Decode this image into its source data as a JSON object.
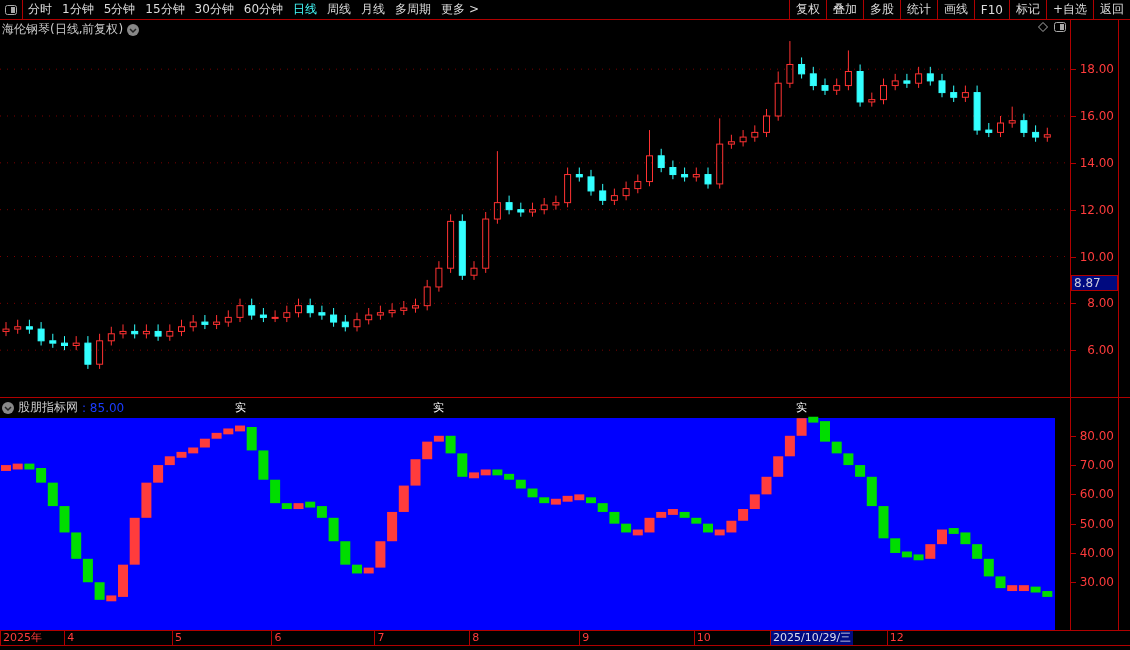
{
  "toolbar": {
    "tabs": [
      {
        "label": "分时",
        "selected": false
      },
      {
        "label": "1分钟",
        "selected": false
      },
      {
        "label": "5分钟",
        "selected": false
      },
      {
        "label": "15分钟",
        "selected": false
      },
      {
        "label": "30分钟",
        "selected": false
      },
      {
        "label": "60分钟",
        "selected": false
      },
      {
        "label": "日线",
        "selected": true
      },
      {
        "label": "周线",
        "selected": false
      },
      {
        "label": "月线",
        "selected": false
      },
      {
        "label": "多周期",
        "selected": false
      },
      {
        "label": "更多 >",
        "selected": false
      }
    ],
    "buttons": [
      "复权",
      "叠加",
      "多股",
      "统计",
      "画线",
      "F10",
      "标记",
      "+自选",
      "返回"
    ]
  },
  "price_panel": {
    "title": "海伦钢琴(日线,前复权)",
    "price_cursor": "8.87",
    "chart_data": {
      "type": "candlestick",
      "grid": true,
      "ylim": [
        4,
        20.1
      ],
      "yticks": [
        {
          "value": 6,
          "label": "6.00"
        },
        {
          "value": 8,
          "label": "8.00"
        },
        {
          "value": 10,
          "label": "10.00"
        },
        {
          "value": 12,
          "label": "12.00"
        },
        {
          "value": 14,
          "label": "14.00"
        },
        {
          "value": 16,
          "label": "16.00"
        },
        {
          "value": 18,
          "label": "18.00"
        }
      ],
      "ohlc": [
        [
          6.8,
          7.2,
          6.6,
          6.9
        ],
        [
          6.9,
          7.3,
          6.7,
          7.0
        ],
        [
          7.0,
          7.3,
          6.7,
          6.9
        ],
        [
          6.9,
          7.2,
          6.2,
          6.4
        ],
        [
          6.4,
          6.7,
          6.1,
          6.3
        ],
        [
          6.3,
          6.6,
          6.0,
          6.2
        ],
        [
          6.2,
          6.6,
          6.0,
          6.3
        ],
        [
          6.3,
          6.6,
          5.2,
          5.4
        ],
        [
          5.4,
          6.7,
          5.2,
          6.4
        ],
        [
          6.4,
          7.0,
          6.2,
          6.7
        ],
        [
          6.7,
          7.1,
          6.5,
          6.8
        ],
        [
          6.8,
          7.1,
          6.5,
          6.7
        ],
        [
          6.7,
          7.1,
          6.5,
          6.8
        ],
        [
          6.8,
          7.1,
          6.4,
          6.6
        ],
        [
          6.6,
          7.1,
          6.4,
          6.8
        ],
        [
          6.8,
          7.3,
          6.6,
          7.0
        ],
        [
          7.0,
          7.5,
          6.8,
          7.2
        ],
        [
          7.2,
          7.5,
          6.9,
          7.1
        ],
        [
          7.1,
          7.5,
          6.9,
          7.2
        ],
        [
          7.2,
          7.7,
          7.0,
          7.4
        ],
        [
          7.4,
          8.2,
          7.2,
          7.9
        ],
        [
          7.9,
          8.2,
          7.3,
          7.5
        ],
        [
          7.5,
          7.8,
          7.2,
          7.4
        ],
        [
          7.4,
          7.7,
          7.2,
          7.4
        ],
        [
          7.4,
          7.9,
          7.2,
          7.6
        ],
        [
          7.6,
          8.2,
          7.4,
          7.9
        ],
        [
          7.9,
          8.2,
          7.4,
          7.6
        ],
        [
          7.6,
          7.9,
          7.3,
          7.5
        ],
        [
          7.5,
          7.8,
          7.0,
          7.2
        ],
        [
          7.2,
          7.5,
          6.8,
          7.0
        ],
        [
          7.0,
          7.6,
          6.8,
          7.3
        ],
        [
          7.3,
          7.8,
          7.1,
          7.5
        ],
        [
          7.5,
          7.9,
          7.3,
          7.6
        ],
        [
          7.6,
          8.0,
          7.4,
          7.7
        ],
        [
          7.7,
          8.1,
          7.5,
          7.8
        ],
        [
          7.8,
          8.2,
          7.6,
          7.9
        ],
        [
          7.9,
          9.0,
          7.7,
          8.7
        ],
        [
          8.7,
          9.8,
          8.5,
          9.5
        ],
        [
          9.5,
          11.8,
          9.3,
          11.5
        ],
        [
          11.5,
          11.8,
          9.0,
          9.2
        ],
        [
          9.2,
          9.8,
          9.0,
          9.5
        ],
        [
          9.5,
          11.9,
          9.3,
          11.6
        ],
        [
          11.6,
          14.5,
          11.4,
          12.3
        ],
        [
          12.3,
          12.6,
          11.8,
          12.0
        ],
        [
          12.0,
          12.3,
          11.7,
          11.9
        ],
        [
          11.9,
          12.3,
          11.7,
          12.0
        ],
        [
          12.0,
          12.5,
          11.8,
          12.2
        ],
        [
          12.2,
          12.6,
          12.0,
          12.3
        ],
        [
          12.3,
          13.8,
          12.1,
          13.5
        ],
        [
          13.5,
          13.8,
          13.2,
          13.4
        ],
        [
          13.4,
          13.7,
          12.6,
          12.8
        ],
        [
          12.8,
          13.1,
          12.2,
          12.4
        ],
        [
          12.4,
          12.9,
          12.2,
          12.6
        ],
        [
          12.6,
          13.2,
          12.4,
          12.9
        ],
        [
          12.9,
          13.5,
          12.7,
          13.2
        ],
        [
          13.2,
          15.4,
          13.0,
          14.3
        ],
        [
          14.3,
          14.6,
          13.6,
          13.8
        ],
        [
          13.8,
          14.1,
          13.3,
          13.5
        ],
        [
          13.5,
          13.8,
          13.2,
          13.4
        ],
        [
          13.4,
          13.8,
          13.2,
          13.5
        ],
        [
          13.5,
          13.8,
          12.9,
          13.1
        ],
        [
          13.1,
          15.9,
          12.9,
          14.8
        ],
        [
          14.8,
          15.2,
          14.6,
          14.9
        ],
        [
          14.9,
          15.4,
          14.7,
          15.1
        ],
        [
          15.1,
          15.6,
          14.9,
          15.3
        ],
        [
          15.3,
          16.3,
          15.1,
          16.0
        ],
        [
          16.0,
          17.9,
          15.8,
          17.4
        ],
        [
          17.4,
          19.2,
          17.2,
          18.2
        ],
        [
          18.2,
          18.5,
          17.6,
          17.8
        ],
        [
          17.8,
          18.1,
          17.1,
          17.3
        ],
        [
          17.3,
          17.6,
          16.9,
          17.1
        ],
        [
          17.1,
          17.6,
          16.9,
          17.3
        ],
        [
          17.3,
          18.8,
          17.1,
          17.9
        ],
        [
          17.9,
          18.2,
          16.4,
          16.6
        ],
        [
          16.6,
          17.0,
          16.4,
          16.7
        ],
        [
          16.7,
          17.6,
          16.5,
          17.3
        ],
        [
          17.3,
          17.8,
          17.1,
          17.5
        ],
        [
          17.5,
          17.8,
          17.2,
          17.4
        ],
        [
          17.4,
          18.1,
          17.2,
          17.8
        ],
        [
          17.8,
          18.1,
          17.3,
          17.5
        ],
        [
          17.5,
          17.8,
          16.8,
          17.0
        ],
        [
          17.0,
          17.3,
          16.6,
          16.8
        ],
        [
          16.8,
          17.3,
          16.6,
          17.0
        ],
        [
          17.0,
          17.3,
          15.2,
          15.4
        ],
        [
          15.4,
          15.7,
          15.1,
          15.3
        ],
        [
          15.3,
          16.0,
          15.1,
          15.7
        ],
        [
          15.7,
          16.4,
          15.5,
          15.8
        ],
        [
          15.8,
          16.1,
          15.1,
          15.3
        ],
        [
          15.3,
          15.6,
          14.9,
          15.1
        ],
        [
          15.1,
          15.5,
          14.9,
          15.2
        ]
      ]
    }
  },
  "indicator_panel": {
    "name": "股朋指标网",
    "value": ": 85.00",
    "date_axis": [
      "2025年",
      "4",
      "5",
      "6",
      "7",
      "8",
      "9",
      "10",
      "12"
    ],
    "date_cursor": "2025/10/29/三",
    "chart_data": {
      "type": "candlestick",
      "ylim": [
        13.7,
        92.9
      ],
      "yticks": [
        {
          "value": 30,
          "label": "30.00"
        },
        {
          "value": 40,
          "label": "40.00"
        },
        {
          "value": 50,
          "label": "50.00"
        },
        {
          "value": 60,
          "label": "60.00"
        },
        {
          "value": 70,
          "label": "70.00"
        },
        {
          "value": 80,
          "label": "80.00"
        }
      ],
      "ohlc": [
        [
          68,
          70,
          68,
          70
        ],
        [
          68.5,
          70.5,
          68.5,
          70.5
        ],
        [
          70.5,
          70.5,
          68.5,
          68.5
        ],
        [
          69,
          69,
          64,
          64
        ],
        [
          64,
          64,
          56,
          56
        ],
        [
          56,
          56,
          47,
          47
        ],
        [
          47,
          47,
          38,
          38
        ],
        [
          38,
          38,
          30,
          30
        ],
        [
          30,
          30,
          24,
          24
        ],
        [
          23.5,
          25.5,
          23.5,
          25.5
        ],
        [
          25,
          36,
          25,
          36
        ],
        [
          36,
          52,
          36,
          52
        ],
        [
          52,
          64,
          52,
          64
        ],
        [
          64,
          70,
          64,
          70
        ],
        [
          70,
          73,
          70,
          73
        ],
        [
          72.5,
          74.5,
          72.5,
          74.5
        ],
        [
          74,
          76,
          74,
          76
        ],
        [
          76,
          79,
          76,
          79
        ],
        [
          79,
          81,
          79,
          81
        ],
        [
          80.5,
          82.5,
          80.5,
          82.5
        ],
        [
          81.5,
          83.5,
          81.5,
          83.5
        ],
        [
          83,
          83,
          75,
          75
        ],
        [
          75,
          75,
          65,
          65
        ],
        [
          65,
          65,
          57,
          57
        ],
        [
          57,
          57,
          55,
          55
        ],
        [
          55,
          57,
          55,
          57
        ],
        [
          57.5,
          57.5,
          55.5,
          55.5
        ],
        [
          56,
          56,
          52,
          52
        ],
        [
          52,
          52,
          44,
          44
        ],
        [
          44,
          44,
          36,
          36
        ],
        [
          36,
          36,
          33,
          33
        ],
        [
          33,
          35,
          33,
          35
        ],
        [
          35,
          44,
          35,
          44
        ],
        [
          44,
          54,
          44,
          54
        ],
        [
          54,
          63,
          54,
          63
        ],
        [
          63,
          72,
          63,
          72
        ],
        [
          72,
          78,
          72,
          78
        ],
        [
          78,
          80,
          78,
          80
        ],
        [
          80,
          80,
          74,
          74
        ],
        [
          74,
          74,
          66,
          66
        ],
        [
          65.5,
          67.5,
          65.5,
          67.5
        ],
        [
          66.5,
          68.5,
          66.5,
          68.5
        ],
        [
          68.5,
          68.5,
          66.5,
          66.5
        ],
        [
          67,
          67,
          65,
          65
        ],
        [
          65,
          65,
          62,
          62
        ],
        [
          62,
          62,
          59,
          59
        ],
        [
          59,
          59,
          57,
          57
        ],
        [
          56.5,
          58.5,
          56.5,
          58.5
        ],
        [
          57.5,
          59.5,
          57.5,
          59.5
        ],
        [
          58,
          60,
          58,
          60
        ],
        [
          59,
          59,
          57,
          57
        ],
        [
          57,
          57,
          54,
          54
        ],
        [
          54,
          54,
          50,
          50
        ],
        [
          50,
          50,
          47,
          47
        ],
        [
          46,
          48,
          46,
          48
        ],
        [
          47,
          52,
          47,
          52
        ],
        [
          52,
          54,
          52,
          54
        ],
        [
          53,
          55,
          53,
          55
        ],
        [
          54,
          54,
          52,
          52
        ],
        [
          52,
          52,
          50,
          50
        ],
        [
          50,
          50,
          47,
          47
        ],
        [
          46,
          48,
          46,
          48
        ],
        [
          47,
          51,
          47,
          51
        ],
        [
          51,
          55,
          51,
          55
        ],
        [
          55,
          60,
          55,
          60
        ],
        [
          60,
          66,
          60,
          66
        ],
        [
          66,
          73,
          66,
          73
        ],
        [
          73,
          80,
          73,
          80
        ],
        [
          80,
          86,
          80,
          86
        ],
        [
          86.5,
          86.5,
          84.5,
          84.5
        ],
        [
          85,
          85,
          78,
          78
        ],
        [
          78,
          78,
          74,
          74
        ],
        [
          74,
          74,
          70,
          70
        ],
        [
          70,
          70,
          66,
          66
        ],
        [
          66,
          66,
          56,
          56
        ],
        [
          56,
          56,
          45,
          45
        ],
        [
          45,
          45,
          40,
          40
        ],
        [
          40.5,
          40.5,
          38.5,
          38.5
        ],
        [
          39.5,
          39.5,
          37.5,
          37.5
        ],
        [
          38,
          43,
          38,
          43
        ],
        [
          43,
          48,
          43,
          48
        ],
        [
          48.5,
          48.5,
          46.5,
          46.5
        ],
        [
          47,
          47,
          43,
          43
        ],
        [
          43,
          43,
          38,
          38
        ],
        [
          38,
          38,
          32,
          32
        ],
        [
          32,
          32,
          28,
          28
        ],
        [
          27,
          29,
          27,
          29
        ],
        [
          27,
          29,
          27,
          29
        ],
        [
          28.5,
          28.5,
          26.5,
          26.5
        ],
        [
          27,
          27,
          25,
          25
        ]
      ],
      "annotations": [
        "实",
        "实",
        "实"
      ]
    }
  }
}
